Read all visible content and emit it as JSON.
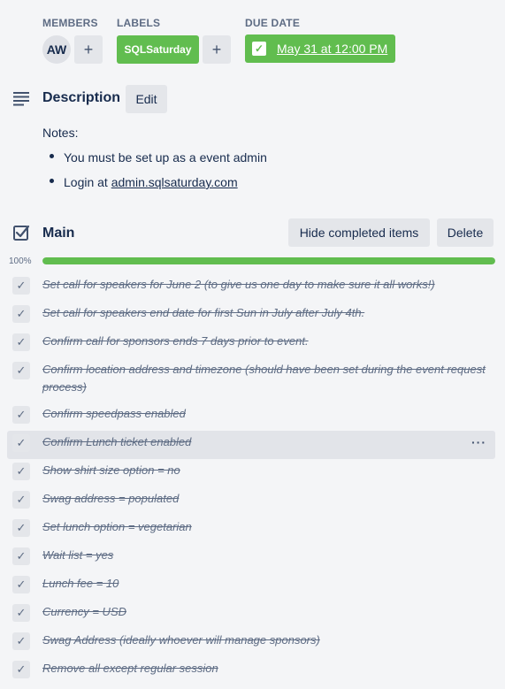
{
  "header": {
    "members_label": "MEMBERS",
    "labels_label": "LABELS",
    "due_label": "DUE DATE"
  },
  "members": {
    "avatar_initials": "AW",
    "add_label": "+"
  },
  "labels": {
    "chip_text": "SQLSaturday",
    "chip_color": "#61bd4f",
    "add_label": "+"
  },
  "due": {
    "text": "May 31 at 12:00 PM",
    "check": "✓",
    "complete": true
  },
  "description": {
    "title": "Description",
    "edit_label": "Edit",
    "notes_heading": "Notes:",
    "bullet1": "You must be set up as a event admin",
    "bullet2_prefix": "Login at ",
    "bullet2_link": "admin.sqlsaturday.com"
  },
  "checklist": {
    "title": "Main",
    "hide_label": "Hide completed items",
    "delete_label": "Delete",
    "progress_text": "100%",
    "progress": 1.0,
    "more_label": "···",
    "items": [
      {
        "text": "Set call for speakers for June 2 (to give us one day to make sure it all works!)",
        "done": true
      },
      {
        "text": "Set call for speakers end date for first Sun in July after July 4th.",
        "done": true
      },
      {
        "text": "Confirm call for sponsors ends 7 days prior to event.",
        "done": true
      },
      {
        "text": "Confirm location address and timezone (should have been set during the event request process)",
        "done": true
      },
      {
        "text": "Confirm speedpass enabled",
        "done": true
      },
      {
        "text": "Confirm Lunch ticket enabled",
        "done": true
      },
      {
        "text": "Show shirt size option = no",
        "done": true
      },
      {
        "text": "Swag address = populated",
        "done": true
      },
      {
        "text": "Set lunch option = vegetarian",
        "done": true
      },
      {
        "text": "Wait list = yes",
        "done": true
      },
      {
        "text": "Lunch fee = 10",
        "done": true
      },
      {
        "text": "Currency = USD",
        "done": true
      },
      {
        "text": "Swag Address (ideally whoever will manage sponsors)",
        "done": true
      },
      {
        "text": "Remove all except regular session",
        "done": true
      }
    ]
  },
  "colors": {
    "accent": "#61bd4f",
    "background": "#f4f5f7",
    "button": "#e4e6ea",
    "text": "#172b4d"
  },
  "icons": {
    "description": "description-lines-icon",
    "checklist": "checklist-checkbox-icon",
    "item_check": "check-icon",
    "more": "more-horizontal-icon"
  }
}
